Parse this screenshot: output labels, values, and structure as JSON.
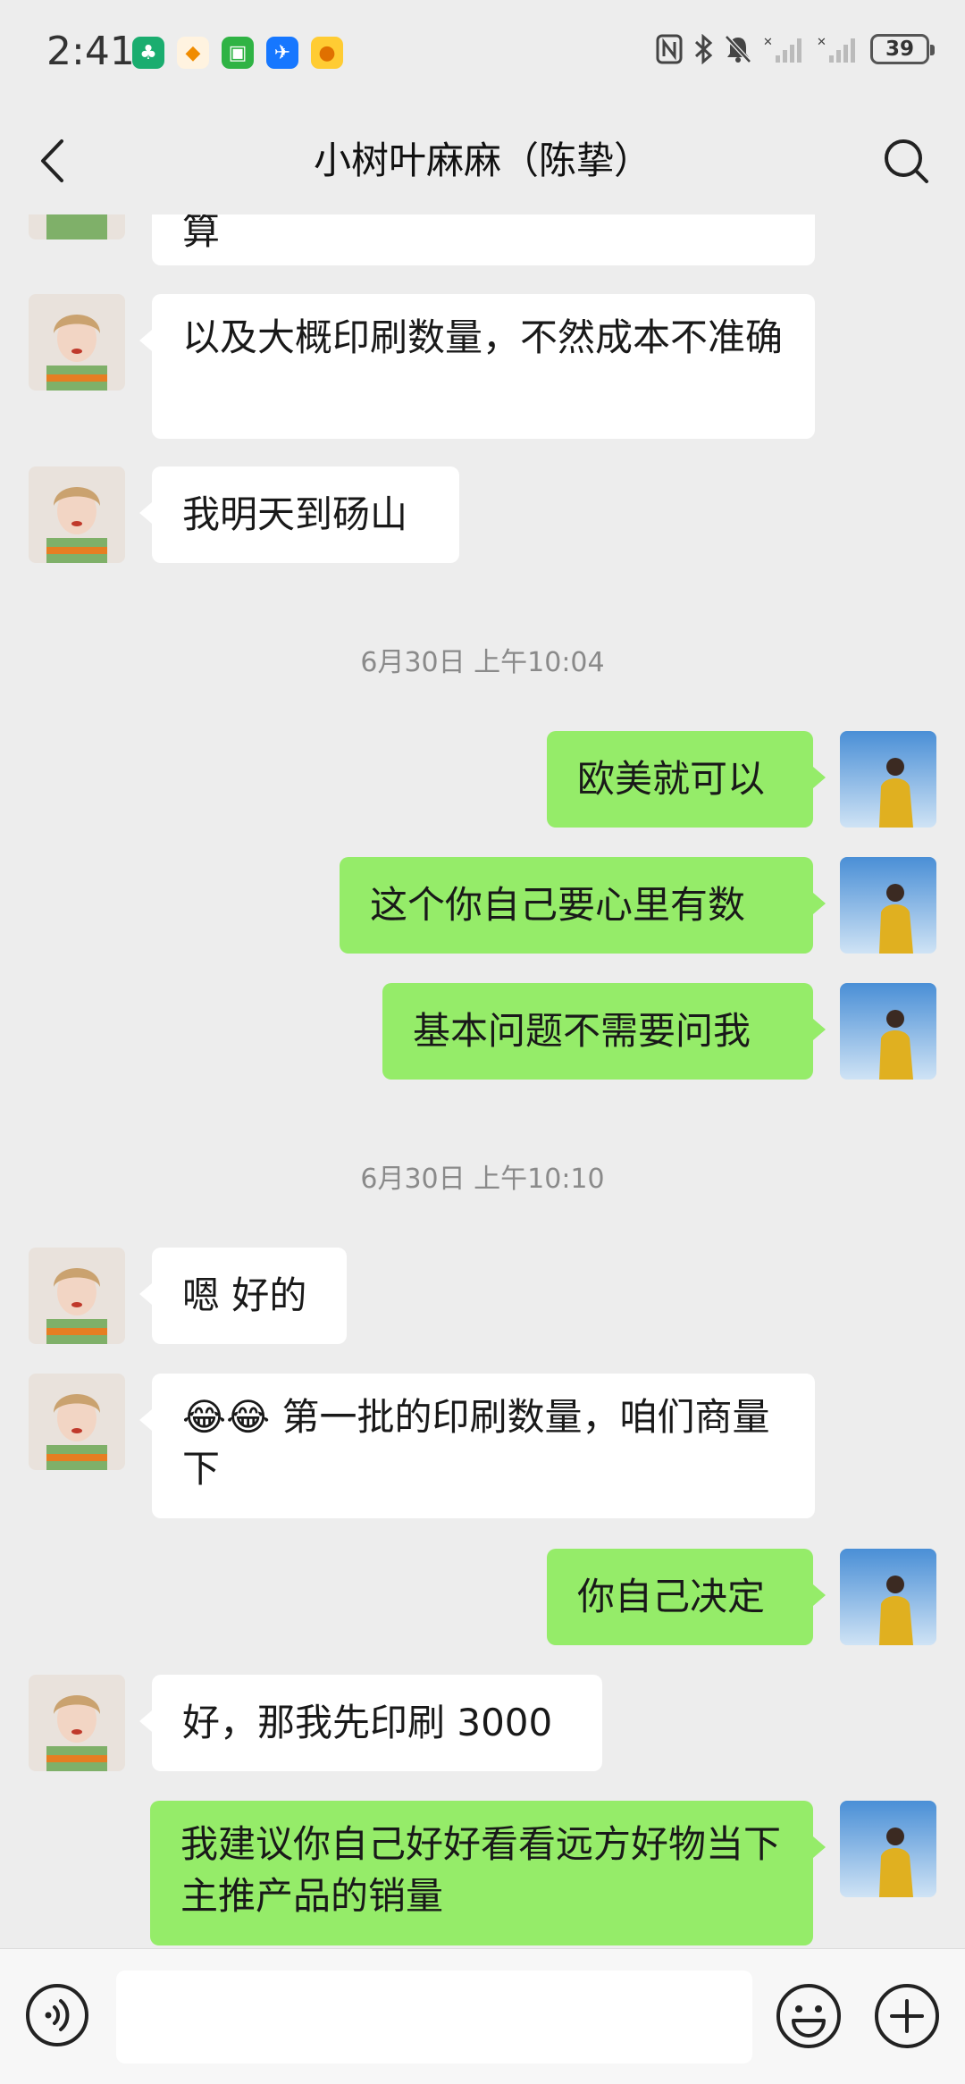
{
  "status_bar": {
    "time": "2:41",
    "battery": "39",
    "app_icons": [
      "tree-app-icon",
      "courier-app-icon",
      "green-app-icon",
      "flight-app-icon",
      "duck-app-icon"
    ],
    "system_icons": [
      "nfc-icon",
      "bluetooth-icon",
      "mute-bell-icon",
      "signal-1-icon",
      "signal-2-icon"
    ]
  },
  "header": {
    "title": "小树叶麻麻（陈挚）"
  },
  "messages": [
    {
      "side": "left",
      "text": "算",
      "partial": true
    },
    {
      "side": "left",
      "text": "以及大概印刷数量，不然成本不准确"
    },
    {
      "side": "left",
      "text": "我明天到砀山"
    },
    {
      "type": "timestamp",
      "text": "6月30日 上午10:04"
    },
    {
      "side": "right",
      "text": "欧美就可以"
    },
    {
      "side": "right",
      "text": "这个你自己要心里有数"
    },
    {
      "side": "right",
      "text": "基本问题不需要问我"
    },
    {
      "type": "timestamp",
      "text": "6月30日 上午10:10"
    },
    {
      "side": "left",
      "text": "嗯 好的"
    },
    {
      "side": "left",
      "text": "😂😂 第一批的印刷数量，咱们商量下"
    },
    {
      "side": "right",
      "text": "你自己决定"
    },
    {
      "side": "left",
      "text": "好，那我先印刷 3000"
    },
    {
      "side": "right",
      "text": "我建议你自己好好看看远方好物当下主推产品的销量"
    }
  ],
  "input_bar": {
    "placeholder": ""
  },
  "colors": {
    "background": "#ededed",
    "sent_bubble": "#95ec69",
    "received_bubble": "#ffffff"
  }
}
